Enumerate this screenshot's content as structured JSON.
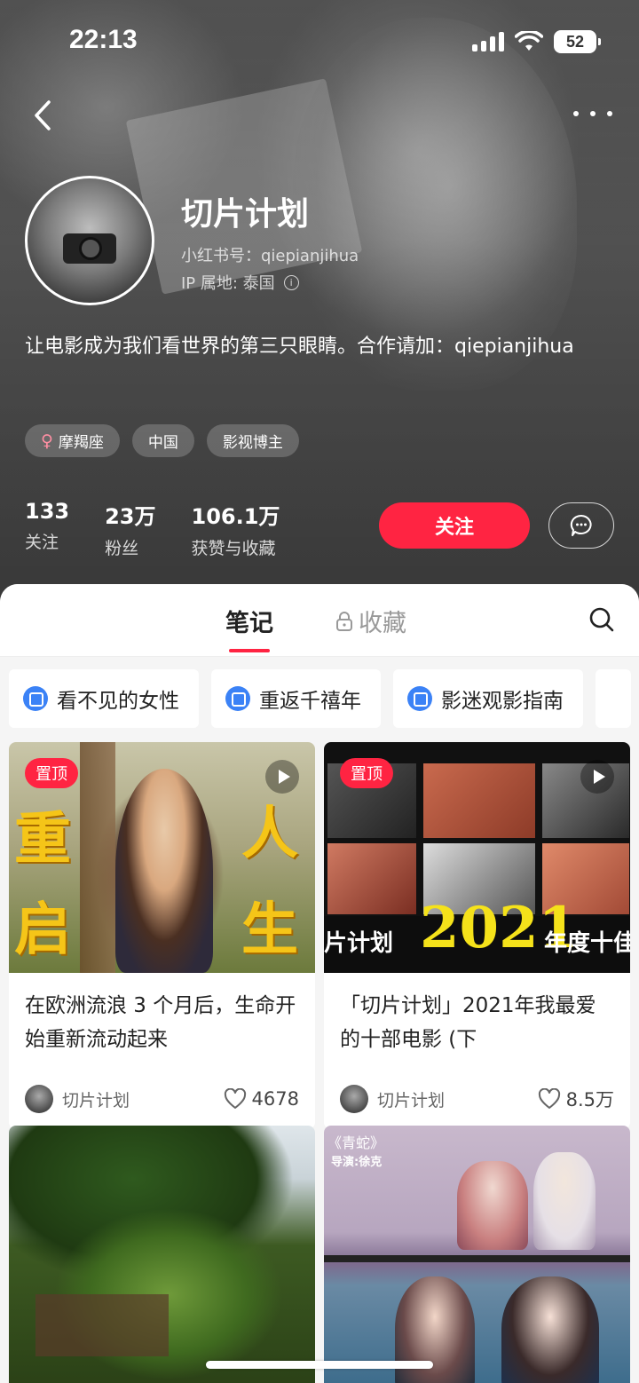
{
  "status_bar": {
    "time": "22:13",
    "battery": "52"
  },
  "profile": {
    "name": "切片计划",
    "red_id": "小红书号：qiepianjihua",
    "ip_location": "IP 属地: 泰国",
    "bio": "让电影成为我们看世界的第三只眼睛。合作请加：qiepianjihua",
    "tags": [
      {
        "label": "摩羯座",
        "icon": "female-icon"
      },
      {
        "label": "中国"
      },
      {
        "label": "影视博主"
      }
    ],
    "stats": [
      {
        "value": "133",
        "label": "关注"
      },
      {
        "value": "23万",
        "label": "粉丝"
      },
      {
        "value": "106.1万",
        "label": "获赞与收藏"
      }
    ],
    "follow_label": "关注"
  },
  "tabs": [
    {
      "label": "笔记",
      "active": true
    },
    {
      "label": "收藏",
      "locked": true
    }
  ],
  "collections": [
    {
      "label": "看不见的女性"
    },
    {
      "label": "重返千禧年"
    },
    {
      "label": "影迷观影指南"
    }
  ],
  "notes": [
    {
      "pinned_label": "置顶",
      "title": "在欧洲流浪 3 个月后，生命开始重新流动起来",
      "author": "切片计划",
      "likes": "4678",
      "overlay": [
        "重",
        "启",
        "人",
        "生"
      ]
    },
    {
      "pinned_label": "置顶",
      "title": "「切片计划」2021年我最爱的十部电影 (下",
      "author": "切片计划",
      "likes": "8.5万",
      "overlay": [
        "片计划",
        "2021",
        "年度十佳"
      ]
    },
    {
      "title": "",
      "author": "",
      "likes": ""
    },
    {
      "caption_title": "《青蛇》",
      "caption_director": "导演:徐克"
    }
  ],
  "colors": {
    "accent": "#ff2442",
    "collection_icon": "#3b82f6"
  }
}
